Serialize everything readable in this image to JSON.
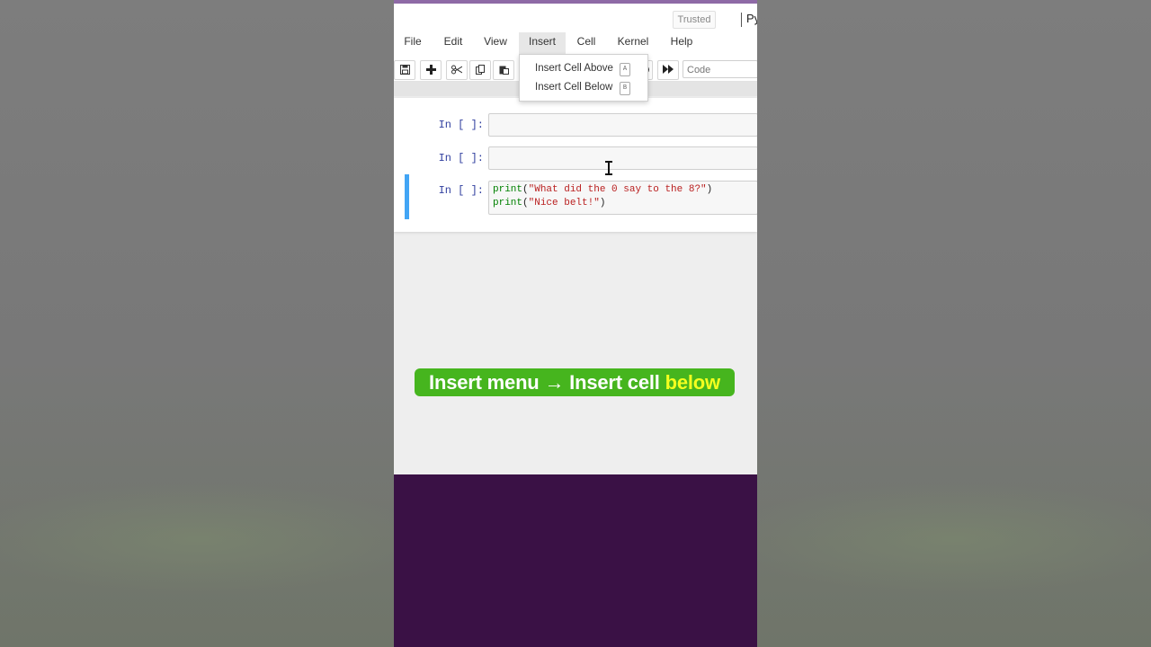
{
  "header": {
    "trusted_label": "Trusted",
    "kernel_name": "Py"
  },
  "menubar": {
    "items": [
      "File",
      "Edit",
      "View",
      "Insert",
      "Cell",
      "Kernel",
      "Help"
    ],
    "active": "Insert"
  },
  "toolbar": {
    "cell_type": "Code",
    "icons": [
      "save-icon",
      "plus-icon",
      "scissors-icon",
      "copy-icon",
      "paste-icon",
      "restart-icon",
      "fast-forward-icon"
    ]
  },
  "insert_menu": {
    "items": [
      {
        "label": "Insert Cell Above",
        "shortcut": "A"
      },
      {
        "label": "Insert Cell Below",
        "shortcut": "B"
      }
    ]
  },
  "cells": [
    {
      "prompt": "In [ ]:",
      "lines": []
    },
    {
      "prompt": "In [ ]:",
      "lines": []
    },
    {
      "prompt": "In [ ]:",
      "selected": true,
      "lines": [
        {
          "fn": "print",
          "open": "(",
          "str": "\"What did the 0 say to the 8?\"",
          "close": ")"
        },
        {
          "fn": "print",
          "open": "(",
          "str": "\"Nice belt!\"",
          "close": ")"
        }
      ]
    }
  ],
  "caption": {
    "text": "Insert menu → Insert cell ",
    "highlight": "below"
  },
  "colors": {
    "caption_bg": "#46b51e",
    "caption_highlight": "#f4ff1f",
    "selected_cell_border": "#42a5f5",
    "footer": "#3a1145"
  }
}
